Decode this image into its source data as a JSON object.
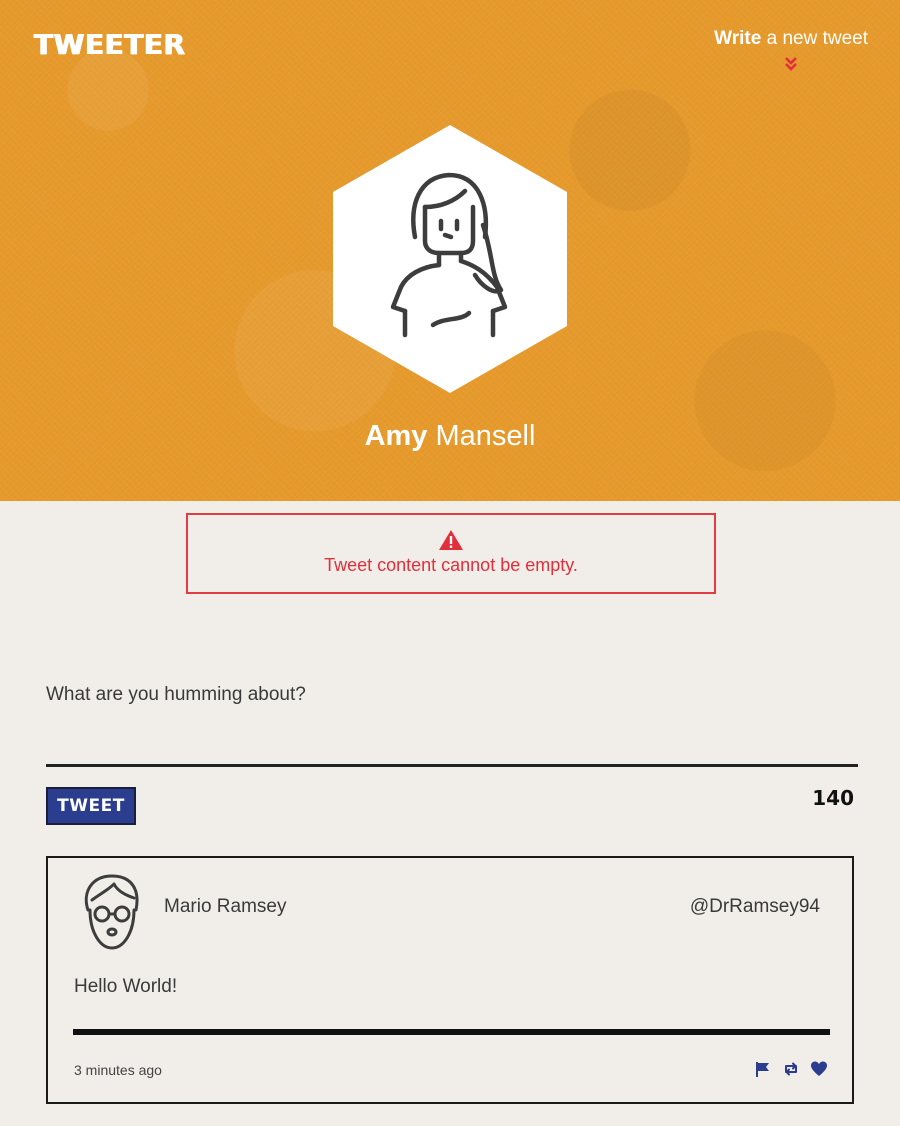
{
  "header": {
    "logo": "TWEETER",
    "write_strong": "Write",
    "write_rest": " a new tweet"
  },
  "profile": {
    "first_name": "Amy",
    "last_name": " Mansell"
  },
  "error": {
    "message": "Tweet content cannot be empty."
  },
  "composer": {
    "label": "What are you humming about?",
    "value": "",
    "button_label": "TWEET",
    "char_count": "140"
  },
  "tweets": [
    {
      "author": "Mario Ramsey",
      "handle": "@DrRamsey94",
      "content": "Hello World!",
      "time": "3 minutes ago"
    }
  ],
  "colors": {
    "hero": "#e69a2c",
    "background": "#f1eee9",
    "error": "#e0303c",
    "accent": "#2b3d8f"
  },
  "icons": {
    "write_chevron": "double-chevron-down-icon",
    "warning": "warning-triangle-icon",
    "flag": "flag-icon",
    "retweet": "retweet-icon",
    "like": "heart-icon"
  }
}
